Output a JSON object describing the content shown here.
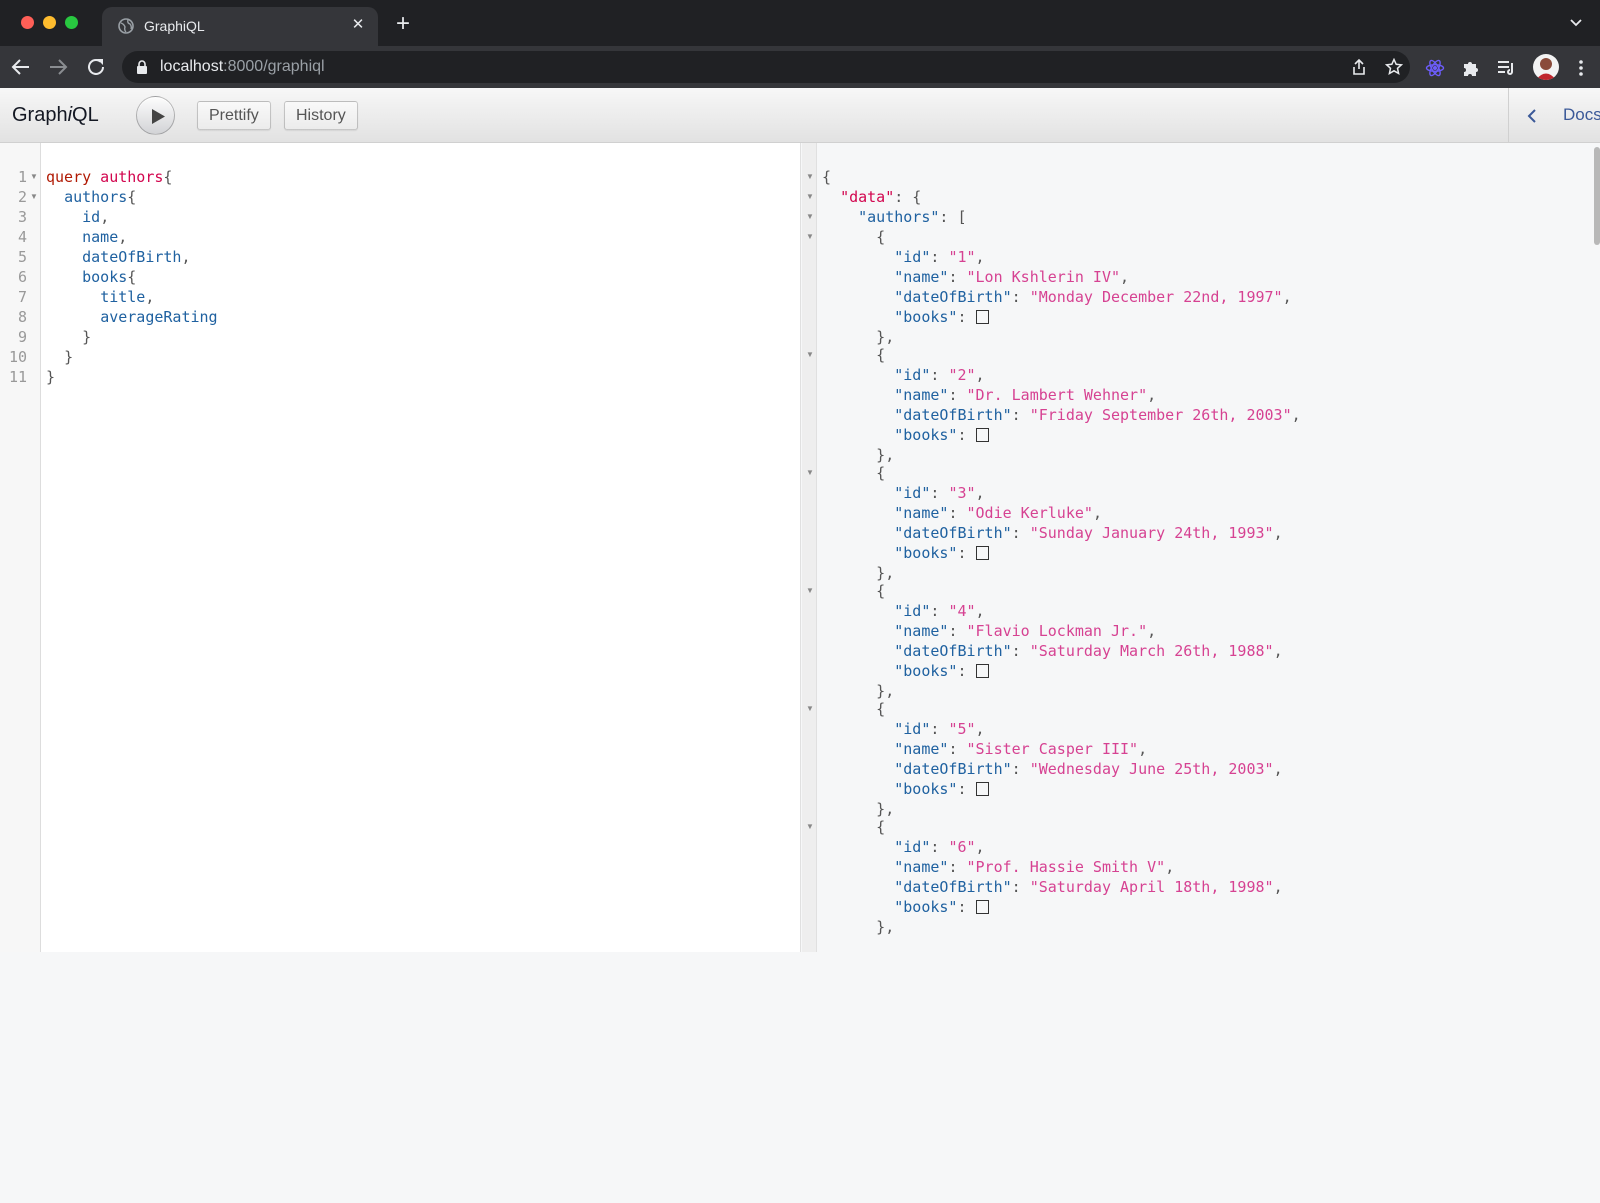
{
  "browser": {
    "tab_title": "GraphiQL",
    "new_tab_label": "+",
    "close_tab_label": "✕",
    "url_host": "localhost",
    "url_path": ":8000/graphiql"
  },
  "graphiql": {
    "title_prefix": "Graph",
    "title_italic": "i",
    "title_suffix": "QL",
    "prettify_label": "Prettify",
    "history_label": "History",
    "docs_label": "Docs"
  },
  "query_editor": {
    "line_numbers": [
      "1",
      "2",
      "3",
      "4",
      "5",
      "6",
      "7",
      "8",
      "9",
      "10",
      "11"
    ],
    "lines": [
      {
        "indent": "",
        "kw": "query",
        "def": " authors",
        "prop": "",
        "punc": "{"
      },
      {
        "indent": "  ",
        "kw": "",
        "def": "",
        "prop": "authors",
        "punc": "{"
      },
      {
        "indent": "    ",
        "kw": "",
        "def": "",
        "prop": "id",
        "punc": ","
      },
      {
        "indent": "    ",
        "kw": "",
        "def": "",
        "prop": "name",
        "punc": ","
      },
      {
        "indent": "    ",
        "kw": "",
        "def": "",
        "prop": "dateOfBirth",
        "punc": ","
      },
      {
        "indent": "    ",
        "kw": "",
        "def": "",
        "prop": "books",
        "punc": "{"
      },
      {
        "indent": "      ",
        "kw": "",
        "def": "",
        "prop": "title",
        "punc": ","
      },
      {
        "indent": "      ",
        "kw": "",
        "def": "",
        "prop": "averageRating",
        "punc": ""
      },
      {
        "indent": "    ",
        "kw": "",
        "def": "",
        "prop": "",
        "punc": "}"
      },
      {
        "indent": "  ",
        "kw": "",
        "def": "",
        "prop": "",
        "punc": "}"
      },
      {
        "indent": "",
        "kw": "",
        "def": "",
        "prop": "",
        "punc": "}"
      }
    ]
  },
  "result": {
    "open_brace": "{",
    "data_key": "\"data\"",
    "authors_key": "\"authors\"",
    "open_bracket": "[",
    "id_key": "\"id\"",
    "name_key": "\"name\"",
    "dob_key": "\"dateOfBirth\"",
    "books_key": "\"books\"",
    "authors": [
      {
        "id": "\"1\"",
        "name": "\"Lon Kshlerin IV\"",
        "dateOfBirth": "\"Monday December 22nd, 1997\""
      },
      {
        "id": "\"2\"",
        "name": "\"Dr. Lambert Wehner\"",
        "dateOfBirth": "\"Friday September 26th, 2003\""
      },
      {
        "id": "\"3\"",
        "name": "\"Odie Kerluke\"",
        "dateOfBirth": "\"Sunday January 24th, 1993\""
      },
      {
        "id": "\"4\"",
        "name": "\"Flavio Lockman Jr.\"",
        "dateOfBirth": "\"Saturday March 26th, 1988\""
      },
      {
        "id": "\"5\"",
        "name": "\"Sister Casper III\"",
        "dateOfBirth": "\"Wednesday June 25th, 2003\""
      },
      {
        "id": "\"6\"",
        "name": "\"Prof. Hassie Smith V\"",
        "dateOfBirth": "\"Saturday April 18th, 1998\""
      }
    ]
  },
  "colors": {
    "keyword": "#b11a04",
    "definition": "#d2054e",
    "property": "#1f61a0",
    "string": "#d64292",
    "docs_link": "#3b5998"
  },
  "icons": {
    "tab_favicon": "globe-icon",
    "back": "arrow-left-icon",
    "forward": "arrow-right-icon",
    "reload": "reload-icon",
    "lock": "lock-icon",
    "share": "share-icon",
    "bookmark": "star-icon",
    "extension_react": "atom-icon",
    "extensions": "puzzle-icon",
    "media": "playlist-icon",
    "menu": "kebab-menu-icon",
    "execute": "play-icon",
    "docs": "chevron-left-icon"
  }
}
